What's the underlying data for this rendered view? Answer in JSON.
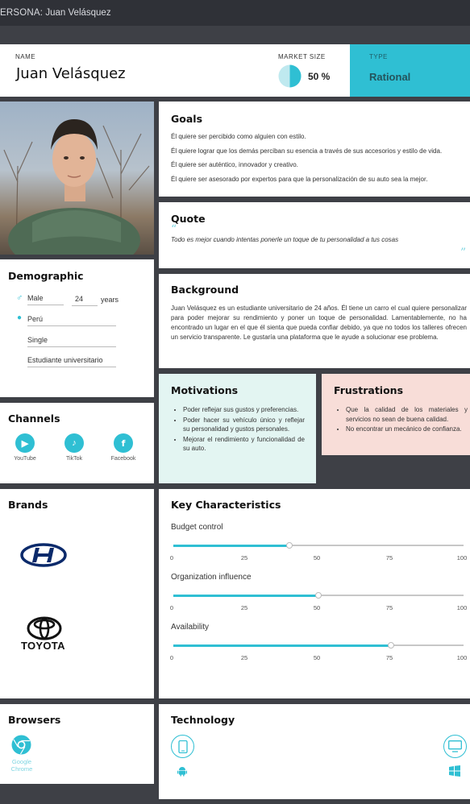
{
  "topbar": {
    "prefix": "ERSONA:",
    "name": "Juan Velásquez"
  },
  "header": {
    "name_label": "NAME",
    "name": "Juan Velásquez",
    "market_label": "MARKET SIZE",
    "market_value": "50 %",
    "market_fraction": 0.5,
    "type_label": "TYPE",
    "type_value": "Rational"
  },
  "goals": {
    "title": "Goals",
    "items": [
      "Él quiere ser percibido como alguien con estilo.",
      "Él quiere lograr que los demás perciban su esencia a través de sus accesorios y estilo de vida.",
      "Él quiere ser auténtico, innovador y creativo.",
      "Él quiere ser asesorado por expertos para que la personalización de su auto sea la mejor."
    ]
  },
  "quote": {
    "title": "Quote",
    "text": "Todo es mejor cuando intentas ponerle un toque de tu personalidad a tus cosas"
  },
  "demographic": {
    "title": "Demographic",
    "gender": "Male",
    "age": "24",
    "age_unit": "years",
    "location": "Perú",
    "status": "Single",
    "occupation": "Estudiante universitario"
  },
  "background": {
    "title": "Background",
    "text": "Juan Velásquez es un estudiante universitario de 24 años. Él tiene un carro el cual quiere personalizar para poder mejorar su rendimiento y poner un toque de personalidad. Lamentablemente, no ha encontrado un lugar en el que él sienta que pueda confiar debido, ya que no todos los talleres ofrecen un servicio transparente. Le gustaría una plataforma que le ayude a solucionar ese problema."
  },
  "motivations": {
    "title": "Motivations",
    "items": [
      "Poder reflejar sus gustos y preferencias.",
      "Poder hacer su vehículo único y reflejar su personalidad y gustos personales.",
      "Mejorar el rendimiento y funcionalidad de su auto."
    ]
  },
  "frustrations": {
    "title": "Frustrations",
    "items": [
      "Que la calidad de los materiales y servicios no sean de buena calidad.",
      "No encontrar un mecánico de confianza."
    ]
  },
  "channels": {
    "title": "Channels",
    "items": [
      {
        "label": "YouTube",
        "icon": "youtube-icon"
      },
      {
        "label": "TikTok",
        "icon": "tiktok-icon"
      },
      {
        "label": "Facebook",
        "icon": "facebook-icon"
      }
    ]
  },
  "brands": {
    "title": "Brands",
    "items": [
      {
        "icon": "hyundai-logo"
      },
      {
        "icon": "toyota-logo",
        "wordmark": "TOYOTA"
      }
    ]
  },
  "characteristics": {
    "title": "Key Characteristics",
    "ticks": [
      "0",
      "25",
      "50",
      "75",
      "100"
    ],
    "items": [
      {
        "label": "Budget control",
        "value": 40
      },
      {
        "label": "Organization influence",
        "value": 50
      },
      {
        "label": "Availability",
        "value": 75
      }
    ]
  },
  "browsers": {
    "title": "Browsers",
    "items": [
      {
        "label": "Google Chrome",
        "icon": "chrome-icon"
      }
    ]
  },
  "technology": {
    "title": "Technology",
    "items": [
      "smartphone-icon",
      "android-icon",
      "desktop-icon",
      "windows-icon"
    ]
  },
  "colors": {
    "accent": "#2fbfd3",
    "motivations_bg": "#e3f5f2",
    "frustrations_bg": "#f8ddd8",
    "dark_bg": "#3e4046"
  }
}
